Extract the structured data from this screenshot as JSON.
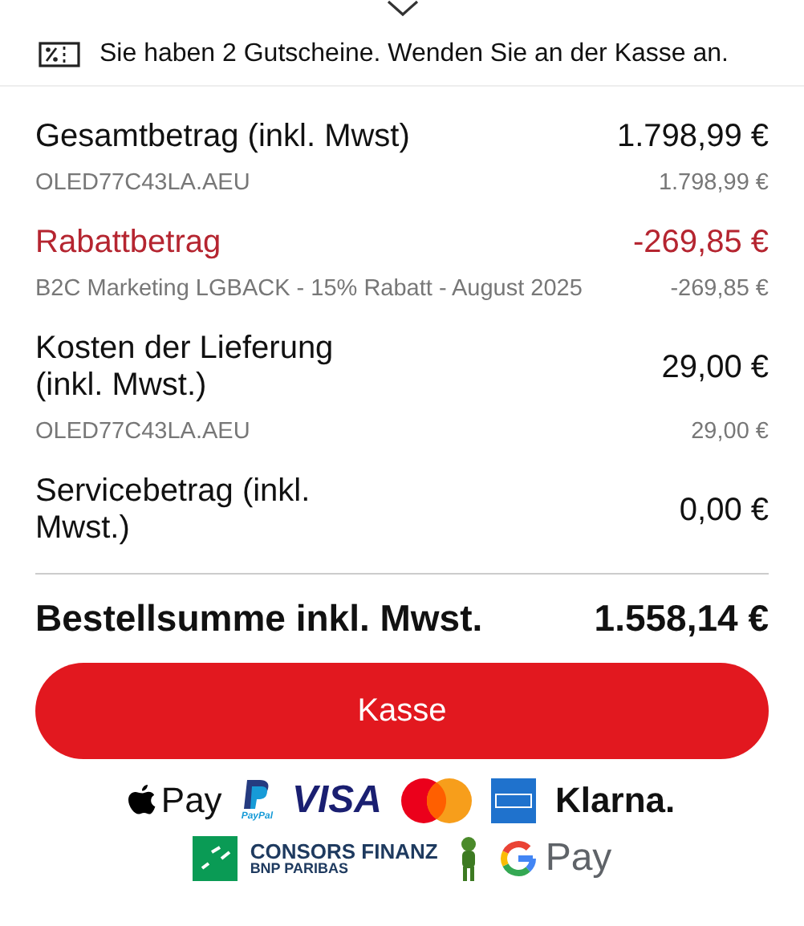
{
  "notice": {
    "text": "Sie haben 2 Gutscheine. Wenden Sie an der Kasse an."
  },
  "lines": [
    {
      "kind": "main",
      "label": "Gesamtbetrag (inkl. Mwst)",
      "amount": "1.798,99 €",
      "details": [
        {
          "label": "OLED77C43LA.AEU",
          "amount": "1.798,99 €"
        }
      ]
    },
    {
      "kind": "discount",
      "label": "Rabattbetrag",
      "amount": "-269,85 €",
      "details": [
        {
          "label": "B2C Marketing LGBACK - 15% Rabatt - August 2025",
          "amount": "-269,85 €"
        }
      ]
    },
    {
      "kind": "main",
      "label": "Kosten der Lieferung (inkl. Mwst.)",
      "amount": "29,00 €",
      "details": [
        {
          "label": "OLED77C43LA.AEU",
          "amount": "29,00 €"
        }
      ]
    },
    {
      "kind": "main",
      "label": "Servicebetrag (inkl. Mwst.)",
      "amount": "0,00 €"
    }
  ],
  "total": {
    "label": "Bestellsumme inkl. Mwst.",
    "amount": "1.558,14 €"
  },
  "checkout_button": "Kasse",
  "payment_rows": [
    [
      {
        "kind": "applepay",
        "text": "Pay"
      },
      {
        "kind": "paypal",
        "text": "PayPal"
      },
      {
        "kind": "visa",
        "text": "VISA"
      },
      {
        "kind": "mastercard"
      },
      {
        "kind": "amex"
      },
      {
        "kind": "klarna",
        "text": "Klarna."
      }
    ],
    [
      {
        "kind": "consors",
        "text": "CONSORS FINANZ",
        "subtext": "BNP PARIBAS"
      },
      {
        "kind": "mascot"
      },
      {
        "kind": "gpay",
        "text": "Pay"
      }
    ]
  ]
}
